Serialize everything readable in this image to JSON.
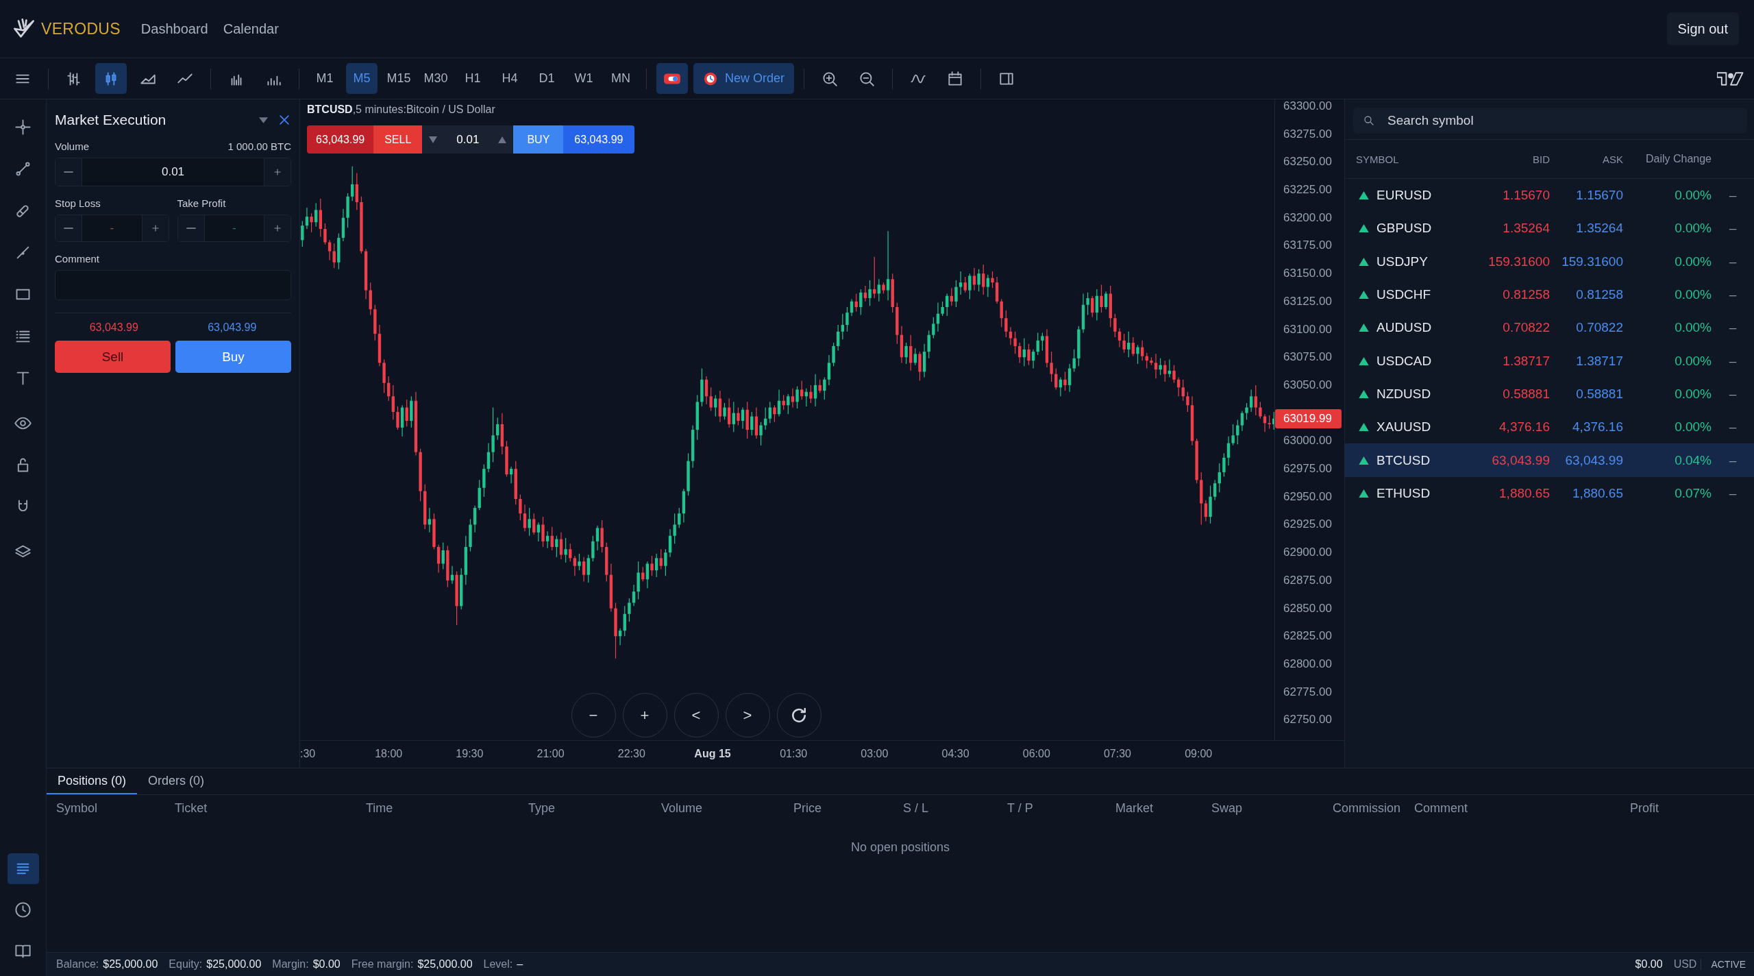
{
  "header": {
    "brand": "VERODUS",
    "nav": [
      {
        "label": "Dashboard"
      },
      {
        "label": "Calendar"
      }
    ],
    "sign_out": "Sign out"
  },
  "toolbar": {
    "chart_types": [
      {
        "kind": "bars",
        "selected": false
      },
      {
        "kind": "candles",
        "selected": true
      },
      {
        "kind": "area",
        "selected": false
      },
      {
        "kind": "line",
        "selected": false
      }
    ],
    "timeframes": [
      {
        "label": "M1",
        "selected": false
      },
      {
        "label": "M5",
        "selected": true
      },
      {
        "label": "M15",
        "selected": false
      },
      {
        "label": "M30",
        "selected": false
      },
      {
        "label": "H1",
        "selected": false
      },
      {
        "label": "H4",
        "selected": false
      },
      {
        "label": "D1",
        "selected": false
      },
      {
        "label": "W1",
        "selected": false
      },
      {
        "label": "MN",
        "selected": false
      }
    ],
    "new_order": "New Order"
  },
  "side_panels": [
    {
      "kind": "positions",
      "selected": true
    },
    {
      "kind": "history",
      "selected": false
    },
    {
      "kind": "journal",
      "selected": false
    }
  ],
  "order_panel": {
    "title": "Market Execution",
    "volume_label": "Volume",
    "volume_limit": "1 000.00 BTC",
    "volume": "0.01",
    "stop_loss_label": "Stop Loss",
    "stop_loss": "-",
    "take_profit_label": "Take Profit",
    "take_profit": "-",
    "comment_label": "Comment",
    "sell_price": "63,043.99",
    "buy_price": "63,043.99",
    "sell": "Sell",
    "buy": "Buy"
  },
  "chart": {
    "title": "**BTCUSD**,5 minutes:Bitcoin / US Dollar",
    "trade": {
      "sell_price": "63,043.99",
      "sell": "SELL",
      "volume": "0.01",
      "buy": "BUY",
      "buy_price": "63,043.99"
    },
    "chart_data": {
      "type": "candlestick",
      "categories": [
        null,
        null,
        null,
        null,
        null,
        null,
        null,
        null,
        null,
        null,
        null,
        null,
        null,
        null,
        null,
        null,
        null,
        null,
        null,
        null,
        null,
        null,
        null,
        null,
        null,
        null,
        null,
        null,
        null,
        null,
        null,
        null,
        null,
        null,
        null,
        null,
        null,
        null,
        null,
        null,
        null,
        null,
        null,
        null,
        null,
        null,
        null,
        null,
        null,
        null,
        null,
        null,
        null,
        null,
        null,
        null,
        null,
        null,
        null,
        null,
        null,
        null,
        null,
        null,
        null,
        null,
        null,
        null,
        null,
        null,
        null,
        null,
        null,
        null,
        null,
        null,
        null,
        null,
        null,
        null,
        null,
        null,
        null,
        null,
        null,
        null,
        null,
        null,
        null,
        null,
        null,
        null,
        null,
        null,
        null,
        null,
        null,
        null,
        null,
        null,
        null,
        null,
        null,
        null,
        null,
        null,
        null,
        null,
        null,
        null,
        null,
        null,
        null,
        null,
        null,
        null,
        null,
        null,
        null,
        null,
        null,
        null,
        null,
        null,
        null,
        null,
        null,
        null,
        null,
        null,
        null,
        null,
        null,
        null,
        null,
        null,
        null,
        null,
        null,
        null,
        null,
        null,
        null,
        null,
        null,
        null,
        null,
        null,
        null,
        null,
        null,
        null,
        null,
        null,
        null,
        null,
        null,
        null,
        null,
        null,
        null,
        null,
        null,
        null,
        null,
        null,
        null,
        null,
        null,
        null,
        null,
        null,
        null,
        null,
        null,
        null,
        null,
        null,
        null,
        null,
        null,
        null,
        null,
        null,
        null,
        null,
        null,
        null,
        null,
        null,
        null,
        null,
        null,
        null,
        null,
        null,
        null,
        null,
        null,
        null,
        null,
        null,
        null,
        null,
        null,
        null,
        null,
        null,
        null,
        null,
        null,
        null,
        null,
        null,
        null,
        null,
        null,
        null,
        null,
        null,
        null,
        null,
        null,
        null,
        null,
        null,
        null,
        null,
        null,
        null
      ],
      "ohlc": [
        [
          63180,
          63197,
          63174,
          63193
        ],
        [
          63193,
          63209,
          63190,
          63201
        ],
        [
          63201,
          63204,
          63187,
          63196
        ],
        [
          63196,
          63213,
          63192,
          63207
        ],
        [
          63207,
          63217,
          63183,
          63190
        ],
        [
          63190,
          63195,
          63176,
          63178
        ],
        [
          63178,
          63180,
          63162,
          63170
        ],
        [
          63170,
          63177,
          63155,
          63160
        ],
        [
          63160,
          63186,
          63154,
          63182
        ],
        [
          63182,
          63208,
          63179,
          63200
        ],
        [
          63200,
          63222,
          63191,
          63219
        ],
        [
          63219,
          63246,
          63215,
          63230
        ],
        [
          63230,
          63240,
          63207,
          63214
        ],
        [
          63214,
          63219,
          63168,
          63170
        ],
        [
          63170,
          63172,
          63127,
          63135
        ],
        [
          63135,
          63142,
          63113,
          63118
        ],
        [
          63118,
          63122,
          63090,
          63096
        ],
        [
          63096,
          63104,
          63067,
          63070
        ],
        [
          63070,
          63073,
          63043,
          63052
        ],
        [
          63052,
          63058,
          63036,
          63040
        ],
        [
          63040,
          63050,
          63019,
          63026
        ],
        [
          63026,
          63031,
          63010,
          63012
        ],
        [
          63012,
          63032,
          63004,
          63030
        ],
        [
          63030,
          63037,
          63013,
          63018
        ],
        [
          63018,
          63040,
          63012,
          63036
        ],
        [
          63036,
          63044,
          62987,
          62990
        ],
        [
          62990,
          62993,
          62946,
          62955
        ],
        [
          62955,
          62961,
          62921,
          62925
        ],
        [
          62925,
          62940,
          62918,
          62930
        ],
        [
          62930,
          62935,
          62903,
          62905
        ],
        [
          62905,
          62907,
          62882,
          62890
        ],
        [
          62890,
          62909,
          62885,
          62902
        ],
        [
          62902,
          62906,
          62869,
          62875
        ],
        [
          62875,
          62888,
          62872,
          62880
        ],
        [
          62880,
          62883,
          62835,
          62852
        ],
        [
          62852,
          62886,
          62849,
          62880
        ],
        [
          62880,
          62915,
          62871,
          62905
        ],
        [
          62905,
          62930,
          62901,
          62925
        ],
        [
          62925,
          62942,
          62918,
          62940
        ],
        [
          62940,
          62965,
          62938,
          62958
        ],
        [
          62958,
          62979,
          62950,
          62975
        ],
        [
          62975,
          62998,
          62972,
          62990
        ],
        [
          62990,
          63030,
          62981,
          63005
        ],
        [
          63005,
          63021,
          63001,
          63015
        ],
        [
          63015,
          63025,
          62988,
          62995
        ],
        [
          62995,
          63000,
          62968,
          62970
        ],
        [
          62970,
          62977,
          62962,
          62975
        ],
        [
          62975,
          62982,
          62943,
          62948
        ],
        [
          62948,
          62952,
          62929,
          62935
        ],
        [
          62935,
          62943,
          62919,
          62922
        ],
        [
          62922,
          62940,
          62915,
          62930
        ],
        [
          62930,
          62935,
          62916,
          62918
        ],
        [
          62918,
          62927,
          62910,
          62925
        ],
        [
          62925,
          62932,
          62905,
          62910
        ],
        [
          62910,
          62919,
          62904,
          62915
        ],
        [
          62915,
          62923,
          62902,
          62905
        ],
        [
          62905,
          62915,
          62896,
          62912
        ],
        [
          62912,
          62918,
          62894,
          62898
        ],
        [
          62898,
          62913,
          62891,
          62903
        ],
        [
          62903,
          62908,
          62892,
          62895
        ],
        [
          62895,
          62897,
          62879,
          62888
        ],
        [
          62888,
          62899,
          62884,
          62892
        ],
        [
          62892,
          62896,
          62874,
          62880
        ],
        [
          62880,
          62898,
          62873,
          62895
        ],
        [
          62895,
          62915,
          62892,
          62910
        ],
        [
          62910,
          62924,
          62902,
          62922
        ],
        [
          62922,
          62929,
          62900,
          62905
        ],
        [
          62905,
          62909,
          62874,
          62880
        ],
        [
          62880,
          62890,
          62847,
          62850
        ],
        [
          62850,
          62855,
          62805,
          62825
        ],
        [
          62825,
          62832,
          62817,
          62830
        ],
        [
          62830,
          62852,
          62825,
          62845
        ],
        [
          62845,
          62859,
          62838,
          62855
        ],
        [
          62855,
          62871,
          62852,
          62865
        ],
        [
          62865,
          62892,
          62858,
          62882
        ],
        [
          62882,
          62887,
          62874,
          62876
        ],
        [
          62876,
          62892,
          62868,
          62890
        ],
        [
          62890,
          62897,
          62879,
          62884
        ],
        [
          62884,
          62899,
          62878,
          62895
        ],
        [
          62895,
          62903,
          62885,
          62888
        ],
        [
          62888,
          62903,
          62879,
          62900
        ],
        [
          62900,
          62921,
          62896,
          62915
        ],
        [
          62915,
          62935,
          62908,
          62925
        ],
        [
          62925,
          62940,
          62922,
          62935
        ],
        [
          62935,
          62957,
          62927,
          62955
        ],
        [
          62955,
          62989,
          62951,
          62982
        ],
        [
          62982,
          63014,
          62976,
          63010
        ],
        [
          63010,
          63041,
          63001,
          63035
        ],
        [
          63035,
          63065,
          63031,
          63055
        ],
        [
          63055,
          63058,
          63033,
          63040
        ],
        [
          63040,
          63048,
          63027,
          63030
        ],
        [
          63030,
          63041,
          63022,
          63038
        ],
        [
          63038,
          63045,
          63017,
          63022
        ],
        [
          63022,
          63034,
          63019,
          63030
        ],
        [
          63030,
          63038,
          63012,
          63015
        ],
        [
          63015,
          63035,
          63008,
          63025
        ],
        [
          63025,
          63030,
          63014,
          63018
        ],
        [
          63018,
          63030,
          63011,
          63028
        ],
        [
          63028,
          63035,
          63002,
          63010
        ],
        [
          63010,
          63026,
          63005,
          63022
        ],
        [
          63022,
          63030,
          63002,
          63005
        ],
        [
          63005,
          63017,
          62996,
          63014
        ],
        [
          63014,
          63030,
          63010,
          63020
        ],
        [
          63020,
          63035,
          63016,
          63030
        ],
        [
          63030,
          63032,
          63017,
          63024
        ],
        [
          63024,
          63046,
          63022,
          63036
        ],
        [
          63036,
          63041,
          63028,
          63032
        ],
        [
          63032,
          63042,
          63024,
          63040
        ],
        [
          63040,
          63047,
          63030,
          63035
        ],
        [
          63035,
          63049,
          63029,
          63046
        ],
        [
          63046,
          63054,
          63037,
          63040
        ],
        [
          63040,
          63047,
          63031,
          63044
        ],
        [
          63044,
          63050,
          63034,
          63038
        ],
        [
          63038,
          63060,
          63031,
          63050
        ],
        [
          63050,
          63055,
          63043,
          63045
        ],
        [
          63045,
          63057,
          63037,
          63055
        ],
        [
          63055,
          63077,
          63050,
          63070
        ],
        [
          63070,
          63088,
          63067,
          63085
        ],
        [
          63085,
          63104,
          63081,
          63098
        ],
        [
          63098,
          63114,
          63091,
          63104
        ],
        [
          63104,
          63120,
          63098,
          63115
        ],
        [
          63115,
          63127,
          63112,
          63125
        ],
        [
          63125,
          63132,
          63116,
          63120
        ],
        [
          63120,
          63136,
          63113,
          63133
        ],
        [
          63133,
          63139,
          63125,
          63128
        ],
        [
          63128,
          63144,
          63121,
          63136
        ],
        [
          63136,
          63165,
          63128,
          63132
        ],
        [
          63132,
          63145,
          63125,
          63140
        ],
        [
          63140,
          63142,
          63132,
          63135
        ],
        [
          63135,
          63188,
          63126,
          63145
        ],
        [
          63145,
          63150,
          63115,
          63120
        ],
        [
          63120,
          63124,
          63087,
          63095
        ],
        [
          63095,
          63103,
          63070,
          63075
        ],
        [
          63075,
          63088,
          63069,
          63085
        ],
        [
          63085,
          63095,
          63063,
          63070
        ],
        [
          63070,
          63083,
          63068,
          63078
        ],
        [
          63078,
          63080,
          63054,
          63062
        ],
        [
          63062,
          63087,
          63057,
          63080
        ],
        [
          63080,
          63099,
          63074,
          63095
        ],
        [
          63095,
          63111,
          63092,
          63105
        ],
        [
          63105,
          63124,
          63098,
          63114
        ],
        [
          63114,
          63125,
          63112,
          63120
        ],
        [
          63120,
          63132,
          63112,
          63130
        ],
        [
          63130,
          63137,
          63121,
          63125
        ],
        [
          63125,
          63144,
          63120,
          63138
        ],
        [
          63138,
          63152,
          63131,
          63142
        ],
        [
          63142,
          63147,
          63133,
          63135
        ],
        [
          63135,
          63150,
          63127,
          63148
        ],
        [
          63148,
          63155,
          63135,
          63140
        ],
        [
          63140,
          63154,
          63134,
          63150
        ],
        [
          63150,
          63158,
          63131,
          63138
        ],
        [
          63138,
          63149,
          63129,
          63146
        ],
        [
          63146,
          63152,
          63137,
          63142
        ],
        [
          63142,
          63147,
          63123,
          63125
        ],
        [
          63125,
          63127,
          63102,
          63110
        ],
        [
          63110,
          63117,
          63093,
          63098
        ],
        [
          63098,
          63102,
          63086,
          63092
        ],
        [
          63092,
          63098,
          63078,
          63085
        ],
        [
          63085,
          63088,
          63070,
          63075
        ],
        [
          63075,
          63092,
          63067,
          63082
        ],
        [
          63082,
          63087,
          63068,
          63072
        ],
        [
          63072,
          63082,
          63065,
          63080
        ],
        [
          63080,
          63097,
          63077,
          63090
        ],
        [
          63090,
          63097,
          63081,
          63094
        ],
        [
          63094,
          63100,
          63066,
          63070
        ],
        [
          63070,
          63080,
          63053,
          63060
        ],
        [
          63060,
          63065,
          63046,
          63048
        ],
        [
          63048,
          63057,
          63040,
          63055
        ],
        [
          63055,
          63062,
          63045,
          63050
        ],
        [
          63050,
          63069,
          63044,
          63065
        ],
        [
          63065,
          63082,
          63062,
          63074
        ],
        [
          63074,
          63103,
          63067,
          63100
        ],
        [
          63100,
          63132,
          63097,
          63122
        ],
        [
          63122,
          63133,
          63113,
          63128
        ],
        [
          63128,
          63130,
          63111,
          63115
        ],
        [
          63115,
          63136,
          63108,
          63130
        ],
        [
          63130,
          63140,
          63115,
          63120
        ],
        [
          63120,
          63134,
          63118,
          63132
        ],
        [
          63132,
          63139,
          63102,
          63110
        ],
        [
          63110,
          63114,
          63093,
          63098
        ],
        [
          63098,
          63101,
          63084,
          63090
        ],
        [
          63090,
          63096,
          63079,
          63082
        ],
        [
          63082,
          63098,
          63075,
          63088
        ],
        [
          63088,
          63093,
          63076,
          63078
        ],
        [
          63078,
          63086,
          63069,
          63084
        ],
        [
          63084,
          63090,
          63072,
          63076
        ],
        [
          63076,
          63079,
          63065,
          63072
        ],
        [
          63072,
          63075,
          63068,
          63070
        ],
        [
          63070,
          63078,
          63056,
          63064
        ],
        [
          63064,
          63074,
          63059,
          63068
        ],
        [
          63068,
          63072,
          63053,
          63060
        ],
        [
          63060,
          63073,
          63057,
          63063
        ],
        [
          63063,
          63068,
          63052,
          63055
        ],
        [
          63055,
          63057,
          63040,
          63048
        ],
        [
          63048,
          63055,
          63036,
          63040
        ],
        [
          63040,
          63044,
          63026,
          63032
        ],
        [
          63032,
          63040,
          62996,
          63000
        ],
        [
          63000,
          63002,
          62962,
          62965
        ],
        [
          62965,
          62972,
          62925,
          62944
        ],
        [
          62944,
          62947,
          62928,
          62932
        ],
        [
          62932,
          62960,
          62926,
          62950
        ],
        [
          62950,
          62965,
          62947,
          62962
        ],
        [
          62962,
          62980,
          62954,
          62972
        ],
        [
          62972,
          62989,
          62968,
          62985
        ],
        [
          62985,
          63004,
          62978,
          62998
        ],
        [
          62998,
          63015,
          62996,
          63005
        ],
        [
          63005,
          63019,
          62997,
          63014
        ],
        [
          63014,
          63027,
          63009,
          63025
        ],
        [
          63025,
          63034,
          63019,
          63030
        ],
        [
          63030,
          63046,
          63026,
          63040
        ],
        [
          63040,
          63050,
          63023,
          63030
        ],
        [
          63030,
          63035,
          63020,
          63022
        ],
        [
          63022,
          63024,
          63008,
          63016
        ],
        [
          63016,
          63023,
          63011,
          63015
        ],
        [
          63015,
          63026,
          63010,
          63020
        ],
        null,
        null,
        null,
        null,
        null,
        null,
        null,
        null,
        null,
        null,
        null,
        null,
        null,
        null,
        null
      ],
      "ylim": [
        62731.8,
        63306.1
      ],
      "yticks": [
        {
          "value": 63300,
          "label": "63300.00"
        },
        {
          "value": 63275,
          "label": "63275.00"
        },
        {
          "value": 63250,
          "label": "63250.00"
        },
        {
          "value": 63225,
          "label": "63225.00"
        },
        {
          "value": 63200,
          "label": "63200.00"
        },
        {
          "value": 63175,
          "label": "63175.00"
        },
        {
          "value": 63150,
          "label": "63150.00"
        },
        {
          "value": 63125,
          "label": "63125.00"
        },
        {
          "value": 63100,
          "label": "63100.00"
        },
        {
          "value": 63075,
          "label": "63075.00"
        },
        {
          "value": 63050,
          "label": "63050.00"
        },
        {
          "value": 63000,
          "label": "63000.00"
        },
        {
          "value": 62975,
          "label": "62975.00"
        },
        {
          "value": 62950,
          "label": "62950.00"
        },
        {
          "value": 62925,
          "label": "62925.00"
        },
        {
          "value": 62900,
          "label": "62900.00"
        },
        {
          "value": 62875,
          "label": "62875.00"
        },
        {
          "value": 62850,
          "label": "62850.00"
        },
        {
          "value": 62825,
          "label": "62825.00"
        },
        {
          "value": 62800,
          "label": "62800.00"
        },
        {
          "value": 62775,
          "label": "62775.00"
        },
        {
          "value": 62750,
          "label": "62750.00"
        }
      ]
    },
    "current_price": "63019.99",
    "time_axis": [
      {
        "text": ":30",
        "bold": false
      },
      {
        "text": "18:00",
        "bold": false
      },
      {
        "text": "19:30",
        "bold": false
      },
      {
        "text": "21:00",
        "bold": false
      },
      {
        "text": "22:30",
        "bold": false
      },
      {
        "text": "Aug 15",
        "bold": true
      },
      {
        "text": "01:30",
        "bold": false
      },
      {
        "text": "03:00",
        "bold": false
      },
      {
        "text": "04:30",
        "bold": false
      },
      {
        "text": "06:00",
        "bold": false
      },
      {
        "text": "07:30",
        "bold": false
      },
      {
        "text": "09:00",
        "bold": false
      }
    ],
    "controls": [
      "−",
      "+",
      "<",
      ">"
    ]
  },
  "watchlist": {
    "search_placeholder": "Search symbol",
    "columns": [
      "SYMBOL",
      "BID",
      "ASK",
      "Daily Change"
    ],
    "rows": [
      {
        "symbol": "EURUSD",
        "bid": "1.15670",
        "ask": "1.15670",
        "change": "0.00%",
        "action": "–",
        "selected": false
      },
      {
        "symbol": "GBPUSD",
        "bid": "1.35264",
        "ask": "1.35264",
        "change": "0.00%",
        "action": "–",
        "selected": false
      },
      {
        "symbol": "USDJPY",
        "bid": "159.31600",
        "ask": "159.31600",
        "change": "0.00%",
        "action": "–",
        "selected": false
      },
      {
        "symbol": "USDCHF",
        "bid": "0.81258",
        "ask": "0.81258",
        "change": "0.00%",
        "action": "–",
        "selected": false
      },
      {
        "symbol": "AUDUSD",
        "bid": "0.70822",
        "ask": "0.70822",
        "change": "0.00%",
        "action": "–",
        "selected": false
      },
      {
        "symbol": "USDCAD",
        "bid": "1.38717",
        "ask": "1.38717",
        "change": "0.00%",
        "action": "–",
        "selected": false
      },
      {
        "symbol": "NZDUSD",
        "bid": "0.58881",
        "ask": "0.58881",
        "change": "0.00%",
        "action": "–",
        "selected": false
      },
      {
        "symbol": "XAUUSD",
        "bid": "4,376.16",
        "ask": "4,376.16",
        "change": "0.00%",
        "action": "–",
        "selected": false
      },
      {
        "symbol": "BTCUSD",
        "bid": "63,043.99",
        "ask": "63,043.99",
        "change": "0.04%",
        "action": "–",
        "selected": true
      },
      {
        "symbol": "ETHUSD",
        "bid": "1,880.65",
        "ask": "1,880.65",
        "change": "0.07%",
        "action": "–",
        "selected": false
      }
    ]
  },
  "positions": {
    "tabs": [
      {
        "label": "Positions (0)",
        "selected": true
      },
      {
        "label": "Orders (0)",
        "selected": false
      }
    ],
    "columns": [
      "Symbol",
      "Ticket",
      "Time",
      "Type",
      "Volume",
      "Price",
      "S / L",
      "T / P",
      "Market",
      "Swap",
      "Commission",
      "Comment",
      "Profit"
    ],
    "empty": "No open positions"
  },
  "status_bar": {
    "items": [
      {
        "label": "Balance:",
        "value": "$25,000.00"
      },
      {
        "label": "Equity:",
        "value": "$25,000.00"
      },
      {
        "label": "Margin:",
        "value": "$0.00"
      },
      {
        "label": "Free margin:",
        "value": "$25,000.00"
      },
      {
        "label": "Level:",
        "value": "–"
      }
    ],
    "total": "$0.00",
    "currency": "USD",
    "state": "ACTIVE"
  }
}
